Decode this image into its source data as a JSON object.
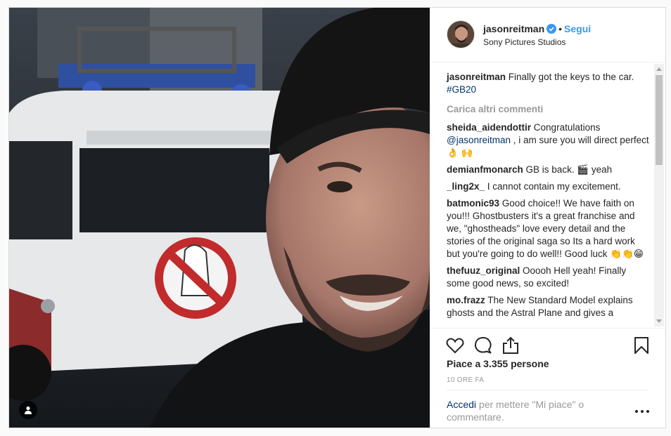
{
  "post": {
    "username": "jasonreitman",
    "follow_label": "Segui",
    "location": "Sony Pictures Studios",
    "caption_user": "jasonreitman",
    "caption_text": "Finally got the keys to the car.",
    "caption_hashtag": "#GB20",
    "load_more": "Carica altri commenti",
    "likes": "Piace a 3.355 persone",
    "time": "10 ORE FA"
  },
  "comments": [
    {
      "user": "sheida_aidendottir",
      "text": "Congratulations",
      "mention": "@jasonreitman",
      "text2": ", i am sure you will direct perfect 👌 🙌"
    },
    {
      "user": "demianfmonarch",
      "text": "GB is back. 🎬 yeah"
    },
    {
      "user": "_ling2x_",
      "text": "I cannot contain my excitement."
    },
    {
      "user": "batmonic93",
      "text": "Good choice!! We have faith on you!!! Ghostbusters it's a great franchise and we, \"ghostheads\" love every detail and the stories of the original saga so Its a hard work but you're going to do well!! Good luck 👏👏😁"
    },
    {
      "user": "thefuuz_original",
      "text": "Ooooh Hell yeah! Finally some good news, so excited!"
    },
    {
      "user": "mo.frazz",
      "text": "The New Standard Model explains ghosts and the Astral Plane and gives a"
    }
  ],
  "footer": {
    "login_link": "Accedi",
    "login_text": "per mettere \"Mi piace\" o commentare."
  },
  "icons": {
    "verified": "verified-badge-icon",
    "like": "heart-icon",
    "comment": "comment-bubble-icon",
    "share": "share-icon",
    "save": "bookmark-icon",
    "more": "more-options-icon",
    "user_tag": "user-tag-icon"
  },
  "colors": {
    "link": "#3897f0",
    "dark_link": "#003569",
    "muted": "#999999",
    "border": "#dbdbdb"
  }
}
